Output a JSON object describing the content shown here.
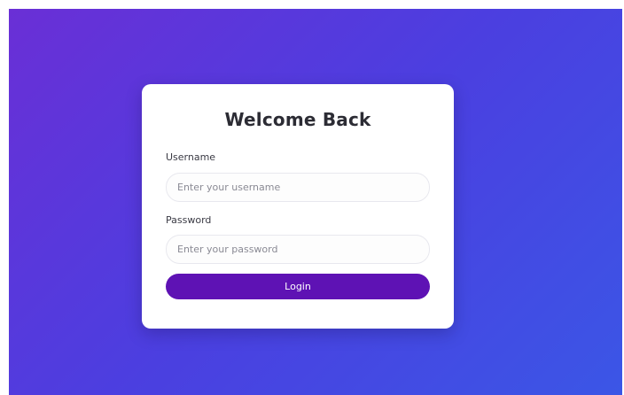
{
  "login": {
    "title": "Welcome Back",
    "username_label": "Username",
    "username_placeholder": "Enter your username",
    "username_value": "",
    "password_label": "Password",
    "password_placeholder": "Enter your password",
    "password_value": "",
    "login_button": "Login"
  },
  "colors": {
    "gradient_start": "#6a2fd6",
    "gradient_end": "#3b56e6",
    "button": "#5e12b4",
    "card": "#ffffff"
  }
}
